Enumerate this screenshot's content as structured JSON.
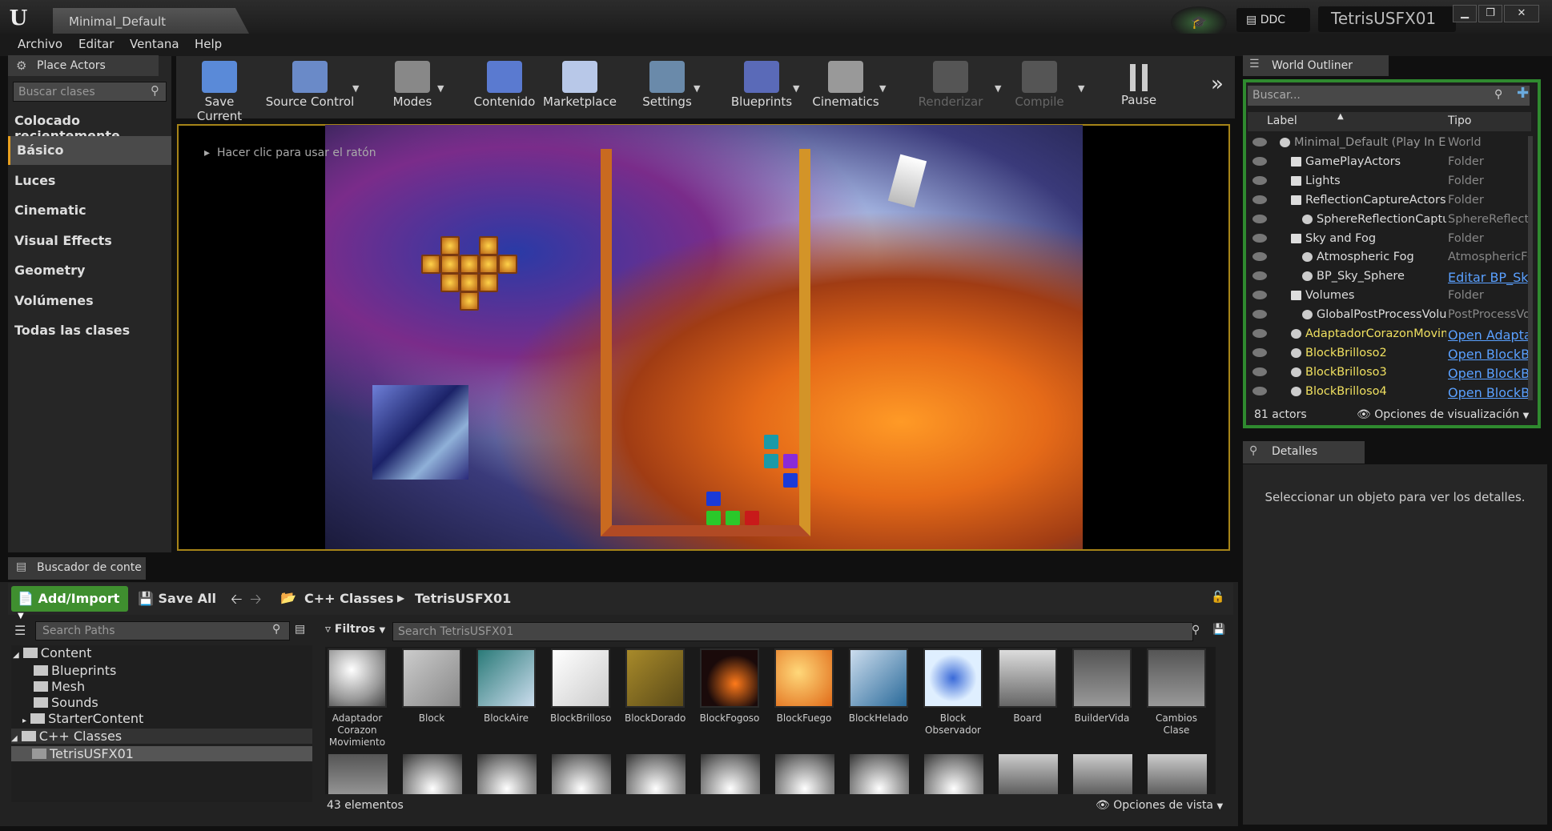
{
  "window": {
    "tab": "Minimal_Default",
    "ddc": "DDC",
    "project": "TetrisUSFX01",
    "min": "▁",
    "max": "❐",
    "close": "✕"
  },
  "menu": [
    "Archivo",
    "Editar",
    "Ventana",
    "Help"
  ],
  "place_actors": {
    "tab": "Place Actors",
    "search_placeholder": "Buscar clases",
    "categories": [
      "Colocado recientemente",
      "Básico",
      "Luces",
      "Cinematic",
      "Visual Effects",
      "Geometry",
      "Volúmenes",
      "Todas las clases"
    ],
    "selected": "Básico"
  },
  "toolbar": {
    "items": [
      {
        "label": "Save Current",
        "icon": "save-icon",
        "color": "#5a8ad8"
      },
      {
        "label": "Source Control",
        "icon": "source-control-icon",
        "color": "#6a8ac8"
      },
      {
        "label": "Modes",
        "icon": "modes-icon",
        "color": "#888"
      },
      {
        "label": "Contenido",
        "icon": "content-icon",
        "color": "#5a7ad0"
      },
      {
        "label": "Marketplace",
        "icon": "marketplace-icon",
        "color": "#b8c8e8"
      },
      {
        "label": "Settings",
        "icon": "settings-icon",
        "color": "#6a8aaa"
      },
      {
        "label": "Blueprints",
        "icon": "blueprints-icon",
        "color": "#5a6ab8"
      },
      {
        "label": "Cinematics",
        "icon": "cinematics-icon",
        "color": "#999"
      },
      {
        "label": "Renderizar",
        "icon": "render-icon",
        "color": "#555"
      },
      {
        "label": "Compile",
        "icon": "compile-icon",
        "color": "#555"
      },
      {
        "label": "Pause",
        "icon": "pause-icon",
        "color": "#ccc"
      }
    ],
    "more": "»"
  },
  "viewport": {
    "hint": "Hacer clic para usar el ratón"
  },
  "content_browser": {
    "tab": "Buscador de conte",
    "add_import": "Add/Import",
    "save_all": "Save All",
    "path": [
      "C++ Classes",
      "TetrisUSFX01"
    ],
    "search_paths_placeholder": "Search Paths",
    "tree": [
      {
        "label": "Content",
        "level": 0
      },
      {
        "label": "Blueprints",
        "level": 1
      },
      {
        "label": "Mesh",
        "level": 1
      },
      {
        "label": "Sounds",
        "level": 1
      },
      {
        "label": "StarterContent",
        "level": 1
      },
      {
        "label": "C++ Classes",
        "level": 0
      },
      {
        "label": "TetrisUSFX01",
        "level": 1
      }
    ],
    "filters": "Filtros",
    "search_assets_placeholder": "Search TetrisUSFX01",
    "assets": [
      "Adaptador Corazon Movimiento",
      "Block",
      "BlockAire",
      "BlockBrilloso",
      "BlockDorado",
      "BlockFogoso",
      "BlockFuego",
      "BlockHelado",
      "Block Observador",
      "Board",
      "BuilderVida",
      "Cambios Clase"
    ],
    "count": "43 elementos",
    "view_options": "Opciones de vista"
  },
  "outliner": {
    "tab": "World Outliner",
    "search_placeholder": "Buscar...",
    "col_label": "Label",
    "col_type": "Tipo",
    "rows": [
      {
        "label": "Minimal_Default (Play In Editor)",
        "type": "World",
        "indent": 0
      },
      {
        "label": "GamePlayActors",
        "type": "Folder",
        "indent": 1
      },
      {
        "label": "Lights",
        "type": "Folder",
        "indent": 1
      },
      {
        "label": "ReflectionCaptureActors",
        "type": "Folder",
        "indent": 1
      },
      {
        "label": "SphereReflectionCapture",
        "type": "SphereReflectionCapture",
        "indent": 2
      },
      {
        "label": "Sky and Fog",
        "type": "Folder",
        "indent": 1
      },
      {
        "label": "Atmospheric Fog",
        "type": "AtmosphericFog",
        "indent": 2
      },
      {
        "label": "BP_Sky_Sphere",
        "type": "Editar BP_Sky_Sphere",
        "indent": 2,
        "link": true
      },
      {
        "label": "Volumes",
        "type": "Folder",
        "indent": 1
      },
      {
        "label": "GlobalPostProcessVolume",
        "type": "PostProcessVolume",
        "indent": 2
      },
      {
        "label": "AdaptadorCorazonMovimiento",
        "type": "Open AdaptadorCorazonMovimiento",
        "indent": 1,
        "link": true,
        "yellow": true
      },
      {
        "label": "BlockBrilloso2",
        "type": "Open BlockBrilloso",
        "indent": 1,
        "link": true,
        "yellow": true
      },
      {
        "label": "BlockBrilloso3",
        "type": "Open BlockBrilloso",
        "indent": 1,
        "link": true,
        "yellow": true
      },
      {
        "label": "BlockBrilloso4",
        "type": "Open BlockBrilloso",
        "indent": 1,
        "link": true,
        "yellow": true
      }
    ],
    "count": "81 actors",
    "view_options": "Opciones de visualización"
  },
  "details": {
    "tab": "Detalles",
    "message": "Seleccionar un objeto para ver los detalles."
  }
}
